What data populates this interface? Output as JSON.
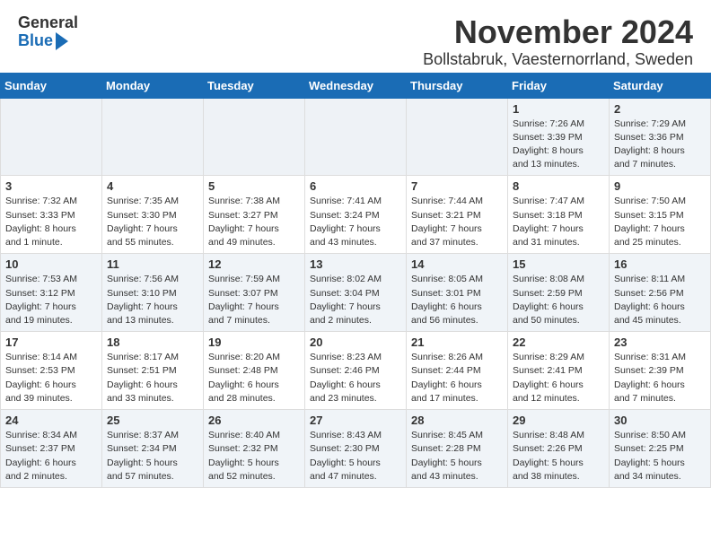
{
  "header": {
    "logo_general": "General",
    "logo_blue": "Blue",
    "title": "November 2024",
    "subtitle": "Bollstabruk, Vaesternorrland, Sweden"
  },
  "weekdays": [
    "Sunday",
    "Monday",
    "Tuesday",
    "Wednesday",
    "Thursday",
    "Friday",
    "Saturday"
  ],
  "weeks": [
    [
      {
        "day": "",
        "info": ""
      },
      {
        "day": "",
        "info": ""
      },
      {
        "day": "",
        "info": ""
      },
      {
        "day": "",
        "info": ""
      },
      {
        "day": "",
        "info": ""
      },
      {
        "day": "1",
        "info": "Sunrise: 7:26 AM\nSunset: 3:39 PM\nDaylight: 8 hours\nand 13 minutes."
      },
      {
        "day": "2",
        "info": "Sunrise: 7:29 AM\nSunset: 3:36 PM\nDaylight: 8 hours\nand 7 minutes."
      }
    ],
    [
      {
        "day": "3",
        "info": "Sunrise: 7:32 AM\nSunset: 3:33 PM\nDaylight: 8 hours\nand 1 minute."
      },
      {
        "day": "4",
        "info": "Sunrise: 7:35 AM\nSunset: 3:30 PM\nDaylight: 7 hours\nand 55 minutes."
      },
      {
        "day": "5",
        "info": "Sunrise: 7:38 AM\nSunset: 3:27 PM\nDaylight: 7 hours\nand 49 minutes."
      },
      {
        "day": "6",
        "info": "Sunrise: 7:41 AM\nSunset: 3:24 PM\nDaylight: 7 hours\nand 43 minutes."
      },
      {
        "day": "7",
        "info": "Sunrise: 7:44 AM\nSunset: 3:21 PM\nDaylight: 7 hours\nand 37 minutes."
      },
      {
        "day": "8",
        "info": "Sunrise: 7:47 AM\nSunset: 3:18 PM\nDaylight: 7 hours\nand 31 minutes."
      },
      {
        "day": "9",
        "info": "Sunrise: 7:50 AM\nSunset: 3:15 PM\nDaylight: 7 hours\nand 25 minutes."
      }
    ],
    [
      {
        "day": "10",
        "info": "Sunrise: 7:53 AM\nSunset: 3:12 PM\nDaylight: 7 hours\nand 19 minutes."
      },
      {
        "day": "11",
        "info": "Sunrise: 7:56 AM\nSunset: 3:10 PM\nDaylight: 7 hours\nand 13 minutes."
      },
      {
        "day": "12",
        "info": "Sunrise: 7:59 AM\nSunset: 3:07 PM\nDaylight: 7 hours\nand 7 minutes."
      },
      {
        "day": "13",
        "info": "Sunrise: 8:02 AM\nSunset: 3:04 PM\nDaylight: 7 hours\nand 2 minutes."
      },
      {
        "day": "14",
        "info": "Sunrise: 8:05 AM\nSunset: 3:01 PM\nDaylight: 6 hours\nand 56 minutes."
      },
      {
        "day": "15",
        "info": "Sunrise: 8:08 AM\nSunset: 2:59 PM\nDaylight: 6 hours\nand 50 minutes."
      },
      {
        "day": "16",
        "info": "Sunrise: 8:11 AM\nSunset: 2:56 PM\nDaylight: 6 hours\nand 45 minutes."
      }
    ],
    [
      {
        "day": "17",
        "info": "Sunrise: 8:14 AM\nSunset: 2:53 PM\nDaylight: 6 hours\nand 39 minutes."
      },
      {
        "day": "18",
        "info": "Sunrise: 8:17 AM\nSunset: 2:51 PM\nDaylight: 6 hours\nand 33 minutes."
      },
      {
        "day": "19",
        "info": "Sunrise: 8:20 AM\nSunset: 2:48 PM\nDaylight: 6 hours\nand 28 minutes."
      },
      {
        "day": "20",
        "info": "Sunrise: 8:23 AM\nSunset: 2:46 PM\nDaylight: 6 hours\nand 23 minutes."
      },
      {
        "day": "21",
        "info": "Sunrise: 8:26 AM\nSunset: 2:44 PM\nDaylight: 6 hours\nand 17 minutes."
      },
      {
        "day": "22",
        "info": "Sunrise: 8:29 AM\nSunset: 2:41 PM\nDaylight: 6 hours\nand 12 minutes."
      },
      {
        "day": "23",
        "info": "Sunrise: 8:31 AM\nSunset: 2:39 PM\nDaylight: 6 hours\nand 7 minutes."
      }
    ],
    [
      {
        "day": "24",
        "info": "Sunrise: 8:34 AM\nSunset: 2:37 PM\nDaylight: 6 hours\nand 2 minutes."
      },
      {
        "day": "25",
        "info": "Sunrise: 8:37 AM\nSunset: 2:34 PM\nDaylight: 5 hours\nand 57 minutes."
      },
      {
        "day": "26",
        "info": "Sunrise: 8:40 AM\nSunset: 2:32 PM\nDaylight: 5 hours\nand 52 minutes."
      },
      {
        "day": "27",
        "info": "Sunrise: 8:43 AM\nSunset: 2:30 PM\nDaylight: 5 hours\nand 47 minutes."
      },
      {
        "day": "28",
        "info": "Sunrise: 8:45 AM\nSunset: 2:28 PM\nDaylight: 5 hours\nand 43 minutes."
      },
      {
        "day": "29",
        "info": "Sunrise: 8:48 AM\nSunset: 2:26 PM\nDaylight: 5 hours\nand 38 minutes."
      },
      {
        "day": "30",
        "info": "Sunrise: 8:50 AM\nSunset: 2:25 PM\nDaylight: 5 hours\nand 34 minutes."
      }
    ]
  ]
}
